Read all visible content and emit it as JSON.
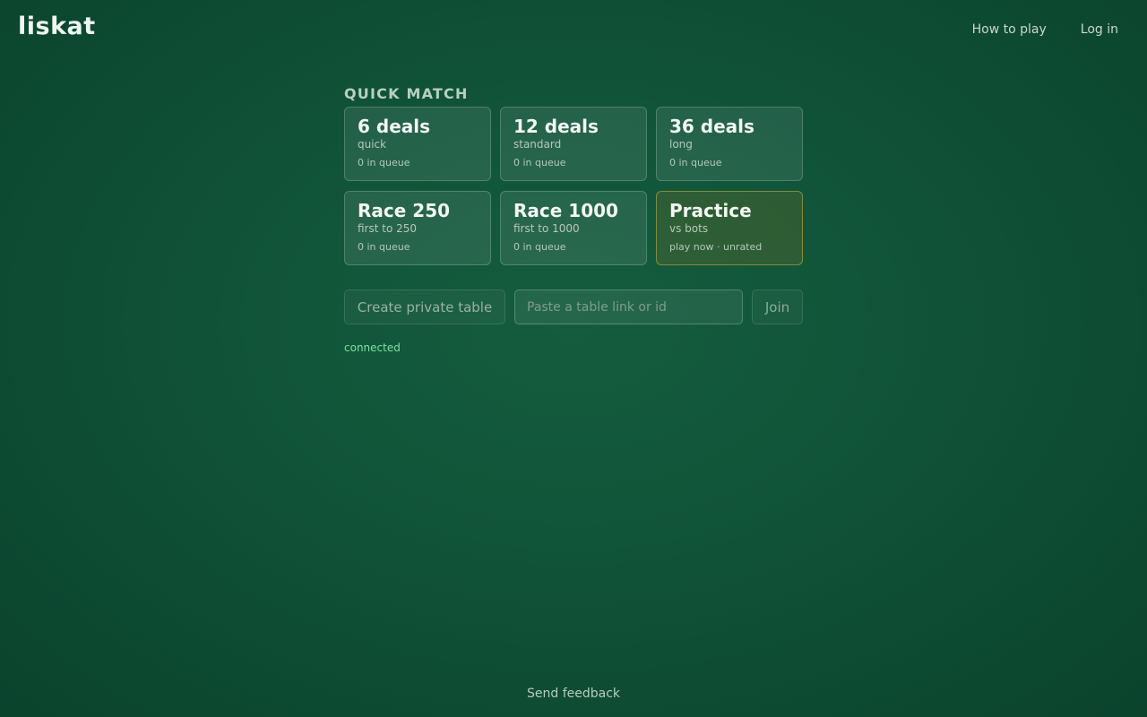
{
  "header": {
    "logo": "liskat",
    "nav": {
      "how_to_play": "How to play",
      "log_in": "Log in"
    }
  },
  "quick_match": {
    "title": "QUICK MATCH",
    "modes": [
      {
        "title": "6 deals",
        "subtitle": "quick",
        "queue": "0 in queue"
      },
      {
        "title": "12 deals",
        "subtitle": "standard",
        "queue": "0 in queue"
      },
      {
        "title": "36 deals",
        "subtitle": "long",
        "queue": "0 in queue"
      },
      {
        "title": "Race 250",
        "subtitle": "first to 250",
        "queue": "0 in queue"
      },
      {
        "title": "Race 1000",
        "subtitle": "first to 1000",
        "queue": "0 in queue"
      },
      {
        "title": "Practice",
        "subtitle": "vs bots",
        "queue": "play now · unrated",
        "highlight_color": "#cdaf46"
      }
    ]
  },
  "private_table": {
    "create_label": "Create private table",
    "input_placeholder": "Paste a table link or id",
    "input_value": "",
    "join_label": "Join"
  },
  "status": {
    "text": "connected",
    "color": "#7fe0a0"
  },
  "footer": {
    "feedback_label": "Send feedback"
  },
  "colors": {
    "background": "#11553a",
    "accent_practice": "#cdaf46"
  }
}
